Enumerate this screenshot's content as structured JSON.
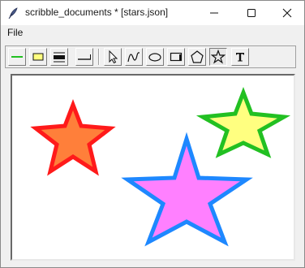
{
  "window": {
    "title": "scribble_documents * [stars.json]"
  },
  "menu": {
    "items": [
      {
        "label": "File"
      }
    ]
  },
  "toolbar": {
    "tools": [
      {
        "icon": "line-color-green-icon"
      },
      {
        "icon": "fill-color-yellow-icon"
      },
      {
        "icon": "line-width-thick-icon"
      },
      {
        "icon": "line-width-thin-icon"
      },
      {
        "icon": "select-arrow-icon"
      },
      {
        "icon": "freehand-curve-icon"
      },
      {
        "icon": "ellipse-icon"
      },
      {
        "icon": "rectangle-icon"
      },
      {
        "icon": "pentagon-icon"
      },
      {
        "icon": "star-icon",
        "active": true
      },
      {
        "icon": "text-tool-icon"
      }
    ]
  },
  "canvas": {
    "shapes": [
      {
        "type": "star",
        "fill": "#ff7f3a",
        "stroke": "#ff1a1a"
      },
      {
        "type": "star",
        "fill": "#ff80ff",
        "stroke": "#1e88ff"
      },
      {
        "type": "star",
        "fill": "#ffff80",
        "stroke": "#22c022"
      }
    ]
  },
  "colors": {
    "accent_green": "#22c022",
    "accent_yellow": "#ffff80",
    "canvas_bg": "#ffffff",
    "chrome_bg": "#f0f0f0"
  }
}
